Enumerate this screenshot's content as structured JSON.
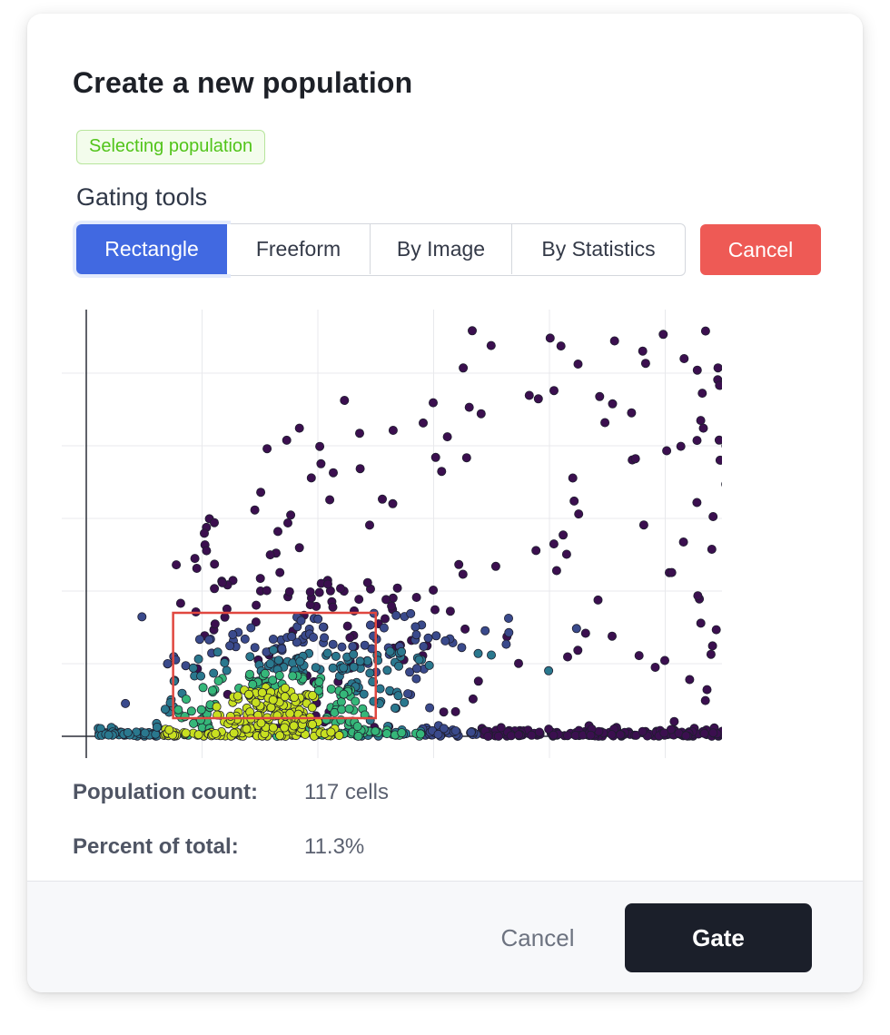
{
  "dialog": {
    "title": "Create a new population",
    "status_badge": "Selecting population",
    "tools_label": "Gating tools",
    "tools": [
      "Rectangle",
      "Freeform",
      "By Image",
      "By Statistics"
    ],
    "active_tool": "Rectangle",
    "cancel_tool_label": "Cancel"
  },
  "stats": {
    "count_label": "Population count:",
    "count_value": "117 cells",
    "percent_label": "Percent of total:",
    "percent_value": "11.3%"
  },
  "footer": {
    "cancel_label": "Cancel",
    "gate_label": "Gate"
  },
  "colors": {
    "accent": "#4169e1",
    "danger": "#ee5a55",
    "selection": "#e0473f",
    "primary_dark": "#1b1f2a"
  },
  "chart_data": {
    "type": "scatter",
    "title": "",
    "xlabel": "",
    "ylabel": "",
    "xlim": [
      0,
      5.6
    ],
    "ylim": [
      0,
      5.8
    ],
    "grid": true,
    "color_scale": "viridis (yellow = high density, purple = low density)",
    "selection_rect": {
      "x": [
        0.75,
        2.5
      ],
      "y": [
        0.25,
        1.7
      ]
    },
    "points_overview": "about 1035 cells; dense cluster near the x-axis between x=0.2 and x=3.0, sparse purple points spread up to y=5.8 at larger x"
  }
}
